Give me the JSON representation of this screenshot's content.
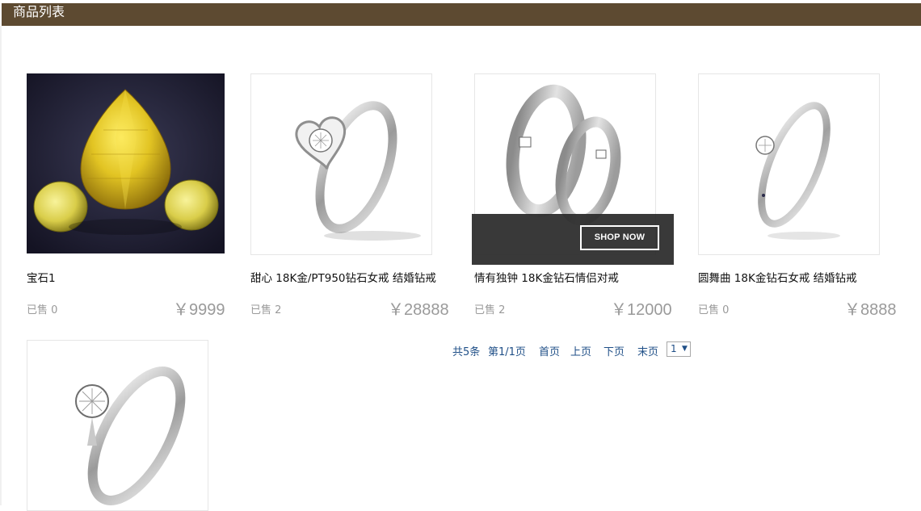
{
  "header": {
    "title": "商品列表"
  },
  "products": [
    {
      "name": "宝石1",
      "sold": "已售 0",
      "price": "￥9999",
      "image": "yellow-gems-image"
    },
    {
      "name": "甜心 18K金/PT950钻石女戒 结婚钻戒",
      "sold": "已售 2",
      "price": "￥28888",
      "image": "heart-ring-image"
    },
    {
      "name": "情有独钟 18K金钻石情侣对戒",
      "sold": "已售 2",
      "price": "￥12000",
      "image": "couple-rings-image"
    },
    {
      "name": "圆舞曲 18K金钻石女戒 结婚钻戒",
      "sold": "已售 0",
      "price": "￥8888",
      "image": "solitaire-ring-image"
    },
    {
      "name": "",
      "sold": "",
      "price": "",
      "image": "six-prong-ring-image"
    }
  ],
  "overlay": {
    "button_label": "SHOP NOW"
  },
  "pager": {
    "total": "共5条",
    "page": "第1/1页",
    "first": "首页",
    "prev": "上页",
    "next": "下页",
    "last": "末页",
    "selected_page": "1"
  },
  "colors": {
    "header_bg": "#5d4a31",
    "link": "#1f4f87",
    "muted": "#9a9a9a"
  }
}
